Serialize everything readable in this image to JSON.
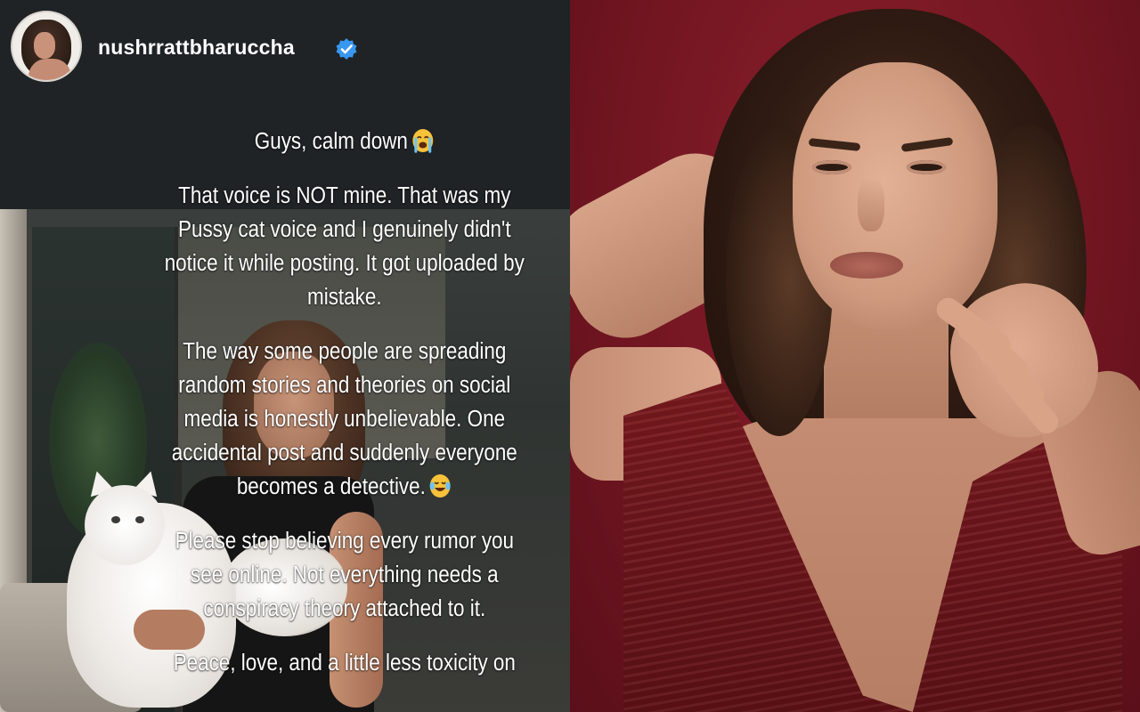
{
  "story": {
    "username": "nushrrattbharuccha",
    "verified_icon": "verified-badge-icon",
    "accent_color": "#3897f0",
    "paragraphs": [
      "Guys, calm down",
      "That voice is NOT mine. That was my Pussy cat voice and I genuinely didn't notice it while posting. It got uploaded by mistake.",
      "The way some people are spreading random stories and theories on social media is honestly unbelievable. One accidental post and suddenly everyone becomes a detective.",
      "Please stop believing every rumor you see online. Not everything needs a conspiracy theory attached to it.",
      "Peace, love, and a little less toxicity on"
    ],
    "emojis": {
      "paragraph_1": "loudly-crying-face-icon",
      "paragraph_3": "face-with-tears-of-joy-icon"
    }
  },
  "portrait": {
    "background_color": "#731622",
    "dress_color": "#6b141a"
  }
}
